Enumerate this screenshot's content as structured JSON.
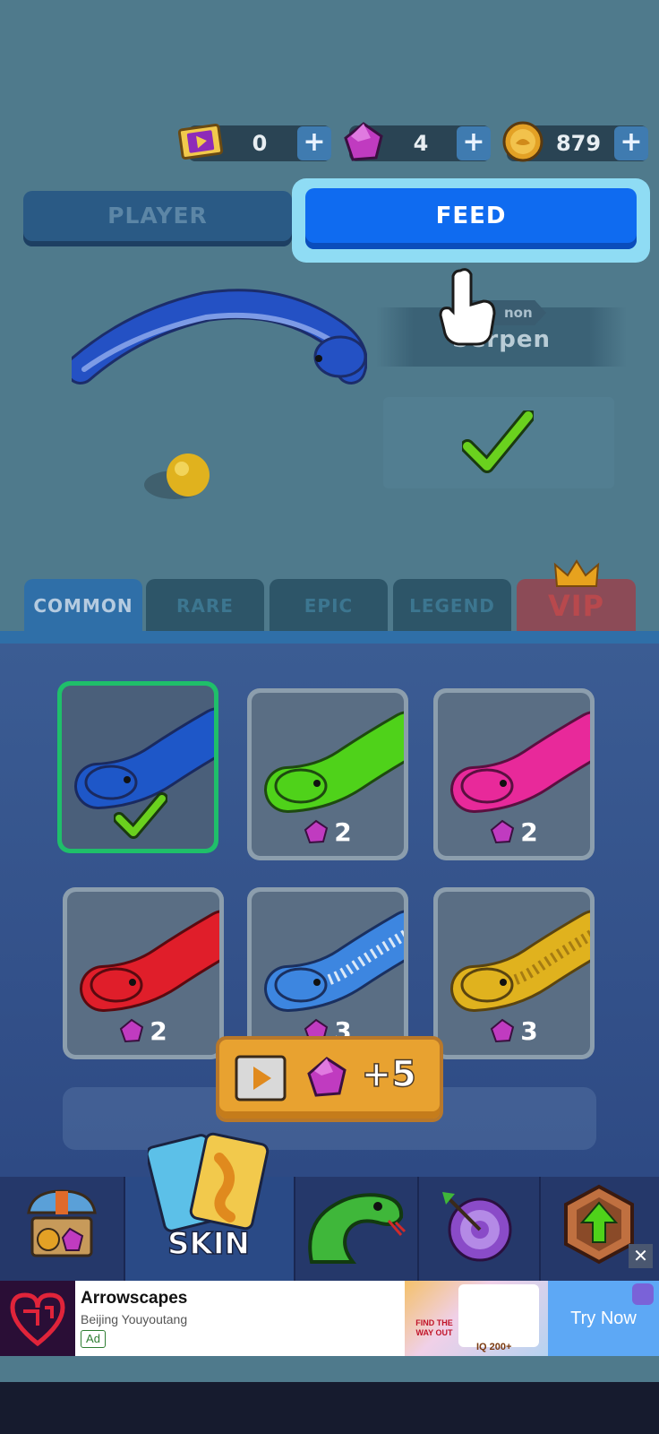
{
  "currencies": [
    {
      "icon": "ticket-icon",
      "value": "0",
      "plus": "+"
    },
    {
      "icon": "gem-icon",
      "value": "4",
      "plus": "+"
    },
    {
      "icon": "coin-icon",
      "value": "879",
      "plus": "+"
    }
  ],
  "mode_buttons": {
    "player": "PLAYER",
    "feed": "FEED"
  },
  "preview": {
    "rarity": "non",
    "name": "Serpen",
    "equipped": true
  },
  "tabs": [
    {
      "label": "COMMON",
      "active": true
    },
    {
      "label": "RARE",
      "active": false
    },
    {
      "label": "EPIC",
      "active": false
    },
    {
      "label": "LEGEND",
      "active": false
    },
    {
      "label": "VIP",
      "active": false
    }
  ],
  "skins": [
    {
      "color": "#1e57c8",
      "price": "",
      "selected": true
    },
    {
      "color": "#4fd21a",
      "price": "2",
      "selected": false
    },
    {
      "color": "#e8299a",
      "price": "2",
      "selected": false
    },
    {
      "color": "#e01e2a",
      "price": "2",
      "selected": false
    },
    {
      "color": "#3d86e0",
      "price": "3",
      "selected": false
    },
    {
      "color": "#e0b21e",
      "price": "3",
      "selected": false
    }
  ],
  "reward": {
    "value": "+5",
    "icon": "play-video-icon"
  },
  "nav": {
    "items": [
      "shop-icon",
      "skin-cards-icon",
      "snake-icon",
      "target-icon",
      "upgrade-icon"
    ],
    "skin_label": "SKIN"
  },
  "ad": {
    "title": "Arrowscapes",
    "subtitle": "Beijing Youyoutang",
    "badge": "Ad",
    "cta": "Try Now",
    "image_text_1": "FIND THE WAY OUT",
    "image_text_2": "IQ 200+",
    "close": "✕"
  }
}
